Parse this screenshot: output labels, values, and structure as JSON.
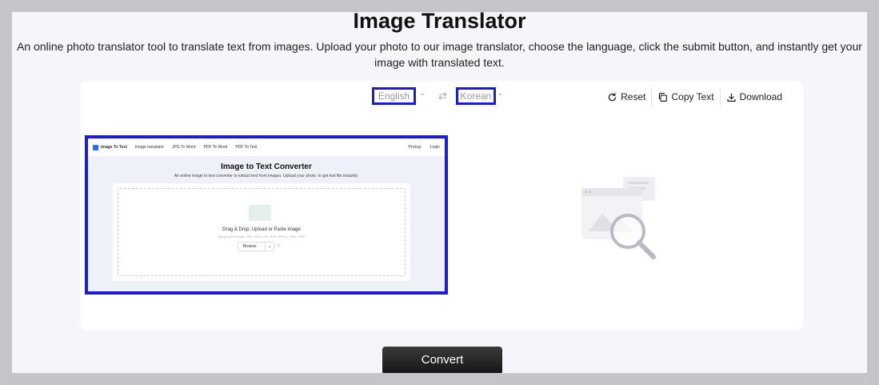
{
  "header": {
    "title": "Image Translator",
    "description": "An online photo translator tool to translate text from images. Upload your photo to our image translator, choose the language, click the submit button, and instantly get your image with translated text."
  },
  "languages": {
    "source": "English",
    "target": "Korean"
  },
  "toolbar": {
    "reset_label": "Reset",
    "copy_label": "Copy Text",
    "download_label": "Download"
  },
  "preview": {
    "logo": "Image To Text",
    "nav": [
      "Image translator",
      "JPG To Word",
      "PDF To Word",
      "PDF To Text"
    ],
    "pricing": "Pricing",
    "login": "Login",
    "title": "Image to Text Converter",
    "subtitle": "An online image to text converter to extract text from images. Upload your photo, to get text file instantly.",
    "drag_text": "Drag & Drop, Upload or Paste image",
    "formats": "Supported formats: JPG, PNG, GIF, JFIF (JPEG), HEIC, PDF",
    "browse": "Browse"
  },
  "convert_label": "Convert",
  "colors": {
    "highlight": "#1b1be0",
    "button": "#1f1f1f",
    "page_bg": "#f5f6f9"
  }
}
